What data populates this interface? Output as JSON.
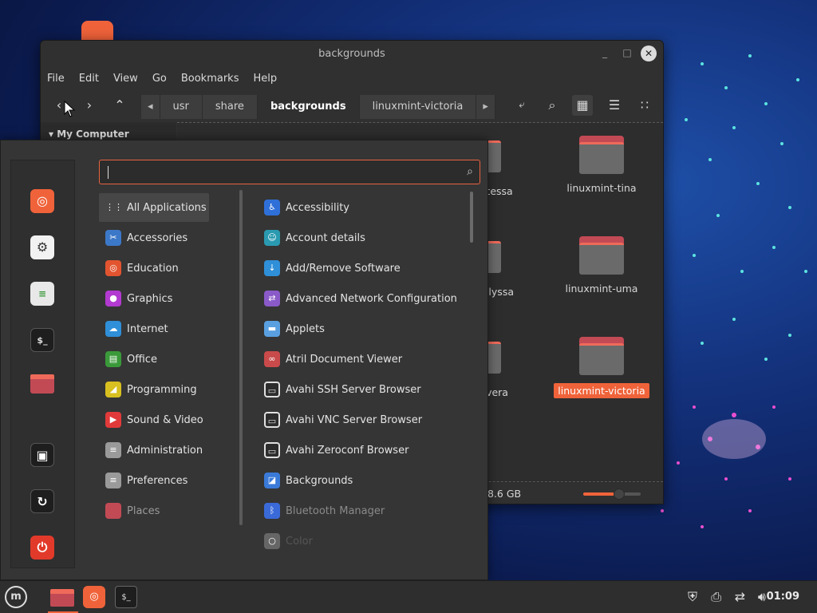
{
  "window": {
    "title": "backgrounds",
    "minimize": "_",
    "maximize": "□",
    "close": "✕",
    "menus": [
      "File",
      "Edit",
      "View",
      "Go",
      "Bookmarks",
      "Help"
    ],
    "breadcrumbs": [
      "usr",
      "share",
      "backgrounds",
      "linuxmint-victoria"
    ],
    "active_crumb": "backgrounds",
    "sidebar_heading": "My Computer",
    "folders": [
      {
        "name": "linuxmint-tina",
        "selected": false
      },
      {
        "name": "linuxmint-uma",
        "selected": false
      },
      {
        "name": "linuxmint-victoria",
        "selected": true
      }
    ],
    "partial_labels": [
      "t-tessa",
      "-ulyssa",
      "t-vera"
    ],
    "free_space": "8.6 GB",
    "zoom_level": 0.62
  },
  "menu": {
    "search_value": "",
    "search_placeholder": "",
    "favorites": [
      "firefox-icon",
      "settings-icon",
      "toggles-icon",
      "terminal-icon",
      "folder-icon",
      "lock-icon",
      "logout-icon",
      "power-icon"
    ],
    "categories": [
      {
        "label": "All Applications",
        "icon": "grid-icon",
        "color": "#474747",
        "active": true
      },
      {
        "label": "Accessories",
        "icon": "scissors-icon",
        "color": "#3c78c8"
      },
      {
        "label": "Education",
        "icon": "education-icon",
        "color": "#e2542f"
      },
      {
        "label": "Graphics",
        "icon": "graphics-icon",
        "color": "#b33ad0"
      },
      {
        "label": "Internet",
        "icon": "cloud-icon",
        "color": "#2f8fd8"
      },
      {
        "label": "Office",
        "icon": "office-icon",
        "color": "#3a9a3a"
      },
      {
        "label": "Programming",
        "icon": "programming-icon",
        "color": "#d8c020"
      },
      {
        "label": "Sound & Video",
        "icon": "play-icon",
        "color": "#e23a3a"
      },
      {
        "label": "Administration",
        "icon": "admin-icon",
        "color": "#9a9a9a"
      },
      {
        "label": "Preferences",
        "icon": "prefs-icon",
        "color": "#9a9a9a"
      },
      {
        "label": "Places",
        "icon": "folder-icon",
        "color": "#c24a55",
        "dim": true
      }
    ],
    "apps": [
      {
        "label": "Accessibility",
        "icon": "accessibility-icon",
        "color": "#2f6fd8"
      },
      {
        "label": "Account details",
        "icon": "account-icon",
        "color": "#2a9ab0"
      },
      {
        "label": "Add/Remove Software",
        "icon": "download-icon",
        "color": "#2f8fd8"
      },
      {
        "label": "Advanced Network Configuration",
        "icon": "network-icon",
        "color": "#8a5ac8"
      },
      {
        "label": "Applets",
        "icon": "applets-icon",
        "color": "#5aa0e0"
      },
      {
        "label": "Atril Document Viewer",
        "icon": "atril-icon",
        "color": "#c84a4a"
      },
      {
        "label": "Avahi SSH Server Browser",
        "icon": "monitor-icon",
        "color": "#d8d8d8"
      },
      {
        "label": "Avahi VNC Server Browser",
        "icon": "monitor-icon",
        "color": "#d8d8d8"
      },
      {
        "label": "Avahi Zeroconf Browser",
        "icon": "monitor-icon",
        "color": "#d8d8d8"
      },
      {
        "label": "Backgrounds",
        "icon": "backgrounds-icon",
        "color": "#3a7ad8"
      },
      {
        "label": "Bluetooth Manager",
        "icon": "bluetooth-icon",
        "color": "#3a6ad8",
        "dim": true
      },
      {
        "label": "Color",
        "icon": "color-icon",
        "color": "#666666",
        "faint": true
      }
    ]
  },
  "taskbar": {
    "clock": "01:09"
  },
  "colors": {
    "accent": "#f0633a"
  }
}
